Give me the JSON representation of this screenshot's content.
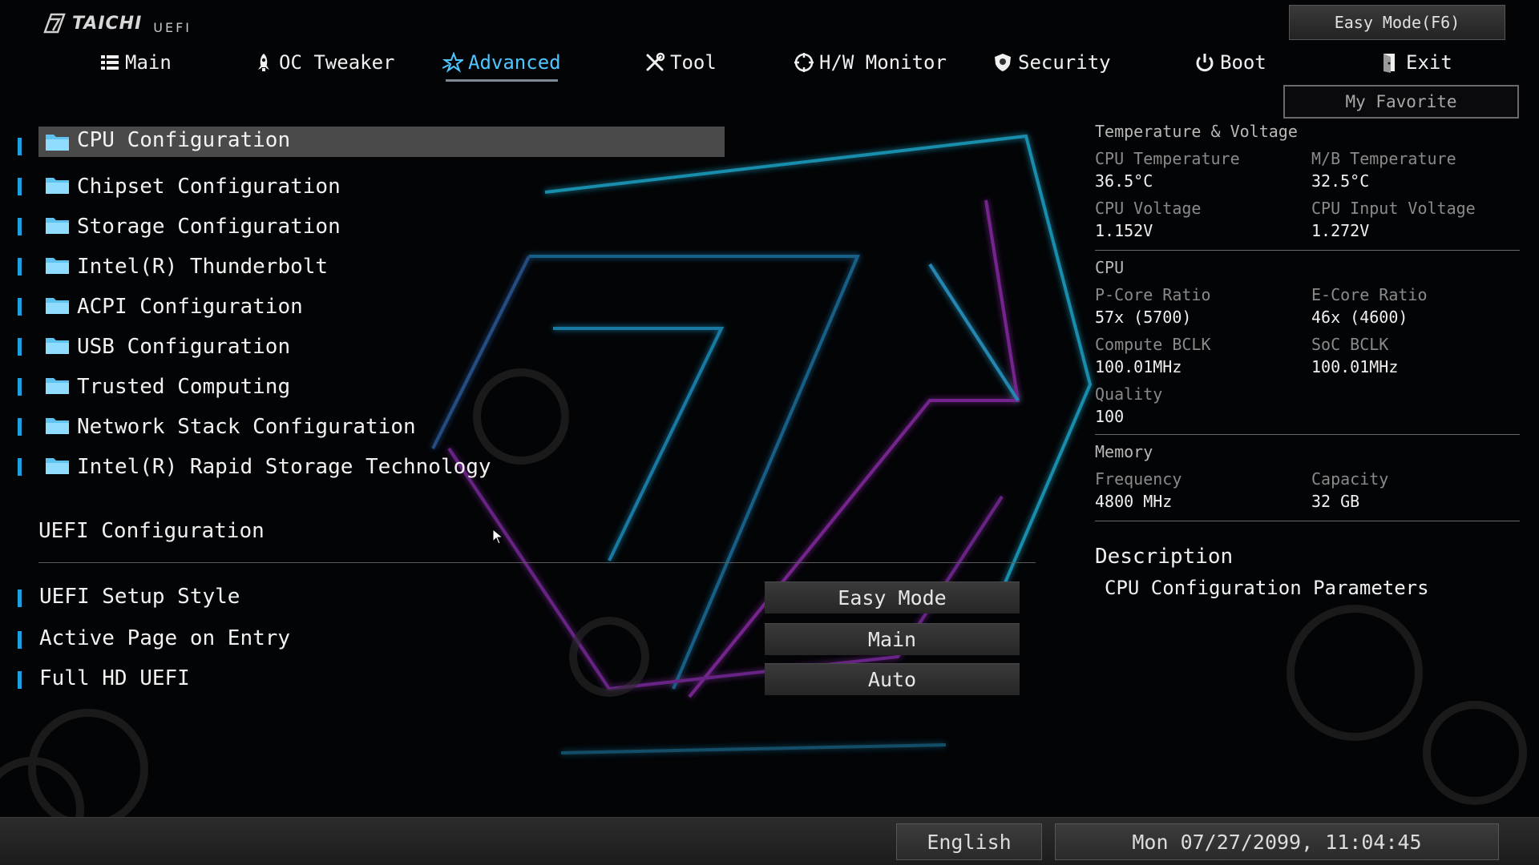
{
  "brand": {
    "name": "TAICHI",
    "sub": "UEFI"
  },
  "easy_mode_button": "Easy Mode(F6)",
  "my_favorite_button": "My Favorite",
  "tabs": [
    {
      "label": "Main",
      "icon": "list-icon"
    },
    {
      "label": "OC Tweaker",
      "icon": "rocket-icon"
    },
    {
      "label": "Advanced",
      "icon": "star-icon",
      "active": true
    },
    {
      "label": "Tool",
      "icon": "tools-icon"
    },
    {
      "label": "H/W Monitor",
      "icon": "monitor-icon"
    },
    {
      "label": "Security",
      "icon": "shield-icon"
    },
    {
      "label": "Boot",
      "icon": "power-icon"
    },
    {
      "label": "Exit",
      "icon": "exit-icon"
    }
  ],
  "menu": [
    {
      "label": "CPU Configuration",
      "selected": true
    },
    {
      "label": "Chipset Configuration"
    },
    {
      "label": "Storage Configuration"
    },
    {
      "label": "Intel(R) Thunderbolt"
    },
    {
      "label": "ACPI Configuration"
    },
    {
      "label": "USB Configuration"
    },
    {
      "label": "Trusted Computing"
    },
    {
      "label": "Network Stack Configuration"
    },
    {
      "label": "Intel(R) Rapid Storage Technology"
    }
  ],
  "uefi_section": {
    "title": "UEFI Configuration",
    "settings": [
      {
        "label": "UEFI Setup Style",
        "value": "Easy Mode"
      },
      {
        "label": "Active Page on Entry",
        "value": "Main"
      },
      {
        "label": "Full HD UEFI",
        "value": "Auto"
      }
    ]
  },
  "status": {
    "temp_voltage_title": "Temperature & Voltage",
    "cpu_temp_label": "CPU Temperature",
    "cpu_temp": "36.5°C",
    "mb_temp_label": "M/B Temperature",
    "mb_temp": "32.5°C",
    "cpu_voltage_label": "CPU Voltage",
    "cpu_voltage": "1.152V",
    "cpu_input_voltage_label": "CPU Input Voltage",
    "cpu_input_voltage": "1.272V",
    "cpu_title": "CPU",
    "pcore_label": "P-Core Ratio",
    "pcore": "57x (5700)",
    "ecore_label": "E-Core Ratio",
    "ecore": "46x (4600)",
    "compute_bclk_label": "Compute BCLK",
    "compute_bclk": "100.01MHz",
    "soc_bclk_label": "SoC BCLK",
    "soc_bclk": "100.01MHz",
    "quality_label": "Quality",
    "quality": "100",
    "memory_title": "Memory",
    "frequency_label": "Frequency",
    "frequency": "4800 MHz",
    "capacity_label": "Capacity",
    "capacity": "32 GB"
  },
  "description": {
    "title": "Description",
    "text": "CPU Configuration Parameters"
  },
  "footer": {
    "language": "English",
    "datetime": "Mon 07/27/2099, 11:04:45"
  },
  "colors": {
    "accent": "#4fc6ff",
    "menu_bar": "#1d9fe0",
    "selection": "#4a4a4a"
  }
}
